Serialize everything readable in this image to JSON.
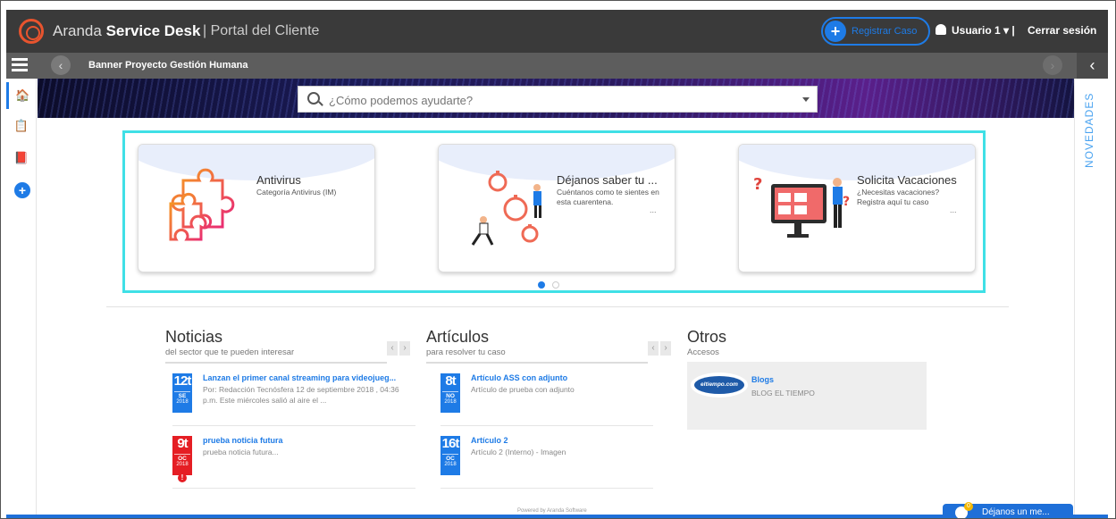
{
  "header": {
    "brand_light": "Aranda",
    "brand_bold": "Service Desk",
    "portal_label": "| Portal del Cliente",
    "register_case": "Registrar Caso",
    "user_name": "Usuario 1",
    "user_caret": "▾ |",
    "logout": "Cerrar sesión"
  },
  "subbar": {
    "banner_title": "Banner Proyecto Gestión Humana",
    "back_glyph": "‹",
    "forward_glyph": "›",
    "collapse_glyph": "‹"
  },
  "left_rail": {
    "icons": [
      "home-icon",
      "clipboard-icon",
      "book-icon",
      "add-icon"
    ],
    "glyphs": [
      "🏠",
      "📋",
      "📕",
      "+"
    ]
  },
  "right_rail": {
    "label": "NOVEDADES"
  },
  "search": {
    "placeholder": "¿Cómo podemos ayudarte?"
  },
  "carousel": {
    "cards": [
      {
        "title": "Antivirus",
        "subtitle": "Categoría Antivirus (IM)",
        "more": ""
      },
      {
        "title": "Déjanos saber tu ...",
        "subtitle": "Cuéntanos como te sientes en esta cuarentena.",
        "more": "..."
      },
      {
        "title": "Solicita Vacaciones",
        "subtitle": "¿Necesitas vacaciones? Registra aquí tu caso",
        "more": "..."
      }
    ],
    "active_page": 1,
    "page_count": 2
  },
  "noticias": {
    "title": "Noticias",
    "subtitle": "del sector que te pueden interesar",
    "items": [
      {
        "day": "12t",
        "month": "SE",
        "year": "2018",
        "title": "Lanzan el primer canal streaming para videojueg...",
        "body": "Por: Redacción Tecnósfera 12 de septiembre 2018 , 04:36 p.m. Este miércoles salió al aire el ..."
      },
      {
        "day": "9t",
        "month": "OC",
        "year": "2018",
        "title": "prueba noticia futura",
        "body": "prueba noticia futura..."
      }
    ]
  },
  "articulos": {
    "title": "Artículos",
    "subtitle": "para resolver tu caso",
    "items": [
      {
        "day": "8t",
        "month": "NO",
        "year": "2018",
        "title": "Artículo ASS con adjunto",
        "body": "Artículo de prueba con adjunto"
      },
      {
        "day": "16t",
        "month": "OC",
        "year": "2018",
        "title": "Artículo 2",
        "body": "Artículo 2 (Interno) - Imagen"
      }
    ]
  },
  "otros": {
    "title": "Otros",
    "subtitle": "Accesos",
    "link_logo": "eltiempo.com",
    "link_title": "Blogs",
    "link_desc": "BLOG EL TIEMPO"
  },
  "footer": {
    "powered": "Powered by Aranda Software",
    "chat_label": "Déjanos un me...",
    "chat_badge": "0"
  },
  "colors": {
    "accent": "#1e7be6",
    "carousel_border": "#3fe0e6",
    "alert": "#e51e24"
  }
}
